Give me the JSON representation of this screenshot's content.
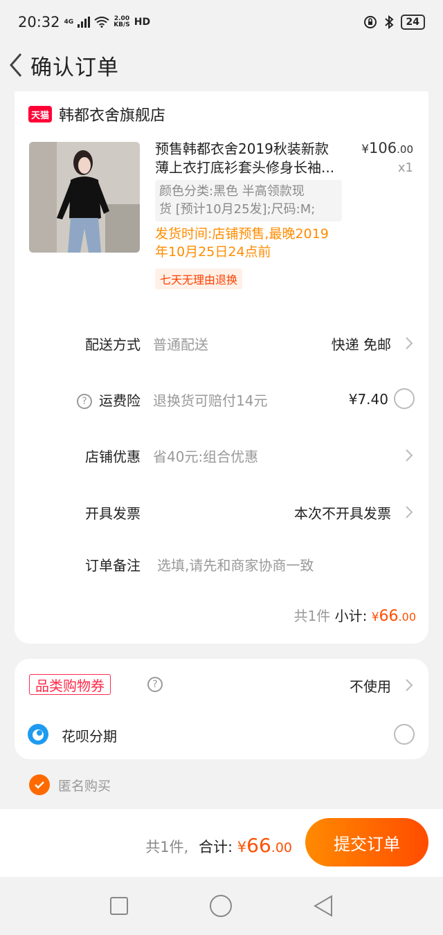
{
  "status": {
    "time": "20:32",
    "network": "4G",
    "speed_top": "2.00",
    "speed_bottom": "KB/S",
    "hd": "HD",
    "battery": "24"
  },
  "nav": {
    "title": "确认订单"
  },
  "shop": {
    "badge": "天猫",
    "name": "韩都衣舍旗舰店"
  },
  "product": {
    "title_line1": "预售韩都衣舍2019秋装新款",
    "title_line2": "薄上衣打底衫套头修身长袖...",
    "price_symbol": "¥",
    "price_int": "106",
    "price_dec": ".00",
    "qty": "x1",
    "sku_line1": "颜色分类:黑色  半高领款现",
    "sku_line2": "货 [预计10月25发];尺码:M;",
    "ship_line1": "发货时间:店铺预售,最晚2019",
    "ship_line2": "年10月25日24点前",
    "tag": "七天无理由退换"
  },
  "rows": {
    "delivery": {
      "label": "配送方式",
      "value": "普通配送",
      "right": "快递 免邮"
    },
    "insurance": {
      "label": "运费险",
      "value": "退换货可赔付14元",
      "right": "¥7.40"
    },
    "discount": {
      "label": "店铺优惠",
      "value": "省40元:组合优惠"
    },
    "invoice": {
      "label": "开具发票",
      "right": "本次不开具发票"
    },
    "note": {
      "label": "订单备注",
      "placeholder": "选填,请先和商家协商一致"
    }
  },
  "subtotal": {
    "count": "共1件",
    "label": "小计:",
    "symbol": "¥",
    "int": "66",
    "dec": ".00"
  },
  "coupon": {
    "label": "品类购物券",
    "right": "不使用"
  },
  "huabei": {
    "label": "花呗分期"
  },
  "anonymous": {
    "label": "匿名购买"
  },
  "bottom": {
    "count": "共1件,",
    "label": "合计:",
    "symbol": "¥",
    "int": "66",
    "dec": ".00",
    "submit": "提交订单"
  },
  "colors": {
    "accent": "#ff5000",
    "ship": "#ff8c00",
    "tmall": "#ff0036"
  }
}
